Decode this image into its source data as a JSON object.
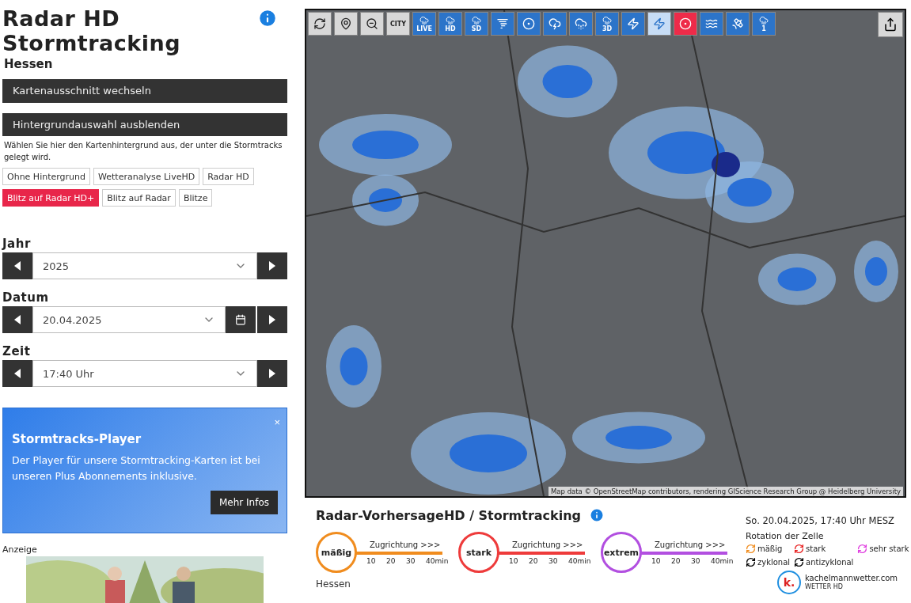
{
  "sidebar": {
    "title": "Radar HD Stormtracking",
    "region": "Hessen",
    "bars": [
      "Kartenausschnitt wechseln",
      "Hintergrundauswahl ausblenden"
    ],
    "background_hint": "Wählen Sie hier den Kartenhintergrund aus, der unter die Stormtracks gelegt wird.",
    "backgrounds": [
      {
        "label": "Ohne Hintergrund",
        "selected": false
      },
      {
        "label": "Wetteranalyse LiveHD",
        "selected": false
      },
      {
        "label": "Radar HD",
        "selected": false
      },
      {
        "label": "Blitz auf Radar HD+",
        "selected": true
      },
      {
        "label": "Blitz auf Radar",
        "selected": false
      },
      {
        "label": "Blitze",
        "selected": false
      }
    ],
    "selectors": [
      {
        "label": "Jahr",
        "value": "2025",
        "calendar": false
      },
      {
        "label": "Datum",
        "value": "20.04.2025",
        "calendar": true
      },
      {
        "label": "Zeit",
        "value": "17:40 Uhr",
        "calendar": false
      }
    ],
    "promo": {
      "close": "×",
      "title": "Stormtracks-Player",
      "text": "Der Player für unsere Stormtracking-Karten ist bei unseren Plus Abonnements inklusive.",
      "button": "Mehr Infos"
    },
    "ad_label": "Anzeige"
  },
  "map": {
    "tools": [
      {
        "kind": "refresh",
        "selected": false
      },
      {
        "kind": "pin",
        "selected": false
      },
      {
        "kind": "zoom",
        "selected": false
      },
      {
        "kind": "city",
        "label": "CITY",
        "selected": false
      },
      {
        "kind": "live",
        "label": "LIVE",
        "selected": false
      },
      {
        "kind": "radar",
        "label": "HD",
        "selected": false
      },
      {
        "kind": "radar",
        "label": "SD",
        "selected": false
      },
      {
        "kind": "tornado",
        "selected": false
      },
      {
        "kind": "ring",
        "selected": false
      },
      {
        "kind": "storm",
        "selected": false
      },
      {
        "kind": "hail",
        "selected": false
      },
      {
        "kind": "radar",
        "label": "3D",
        "selected": false
      },
      {
        "kind": "lightning",
        "selected": false
      },
      {
        "kind": "lightning",
        "selected": true
      },
      {
        "kind": "symbol",
        "selected": false
      },
      {
        "kind": "flood",
        "selected": false
      },
      {
        "kind": "satellite",
        "selected": false
      },
      {
        "kind": "radar",
        "label": "1",
        "selected": false
      }
    ],
    "attribution": "Map data © OpenStreetMap contributors, rendering GIScience Research Group @ Heidelberg University"
  },
  "legend": {
    "title": "Radar-VorhersageHD / Stormtracking",
    "region": "Hessen",
    "timestamp": "So. 20.04.2025, 17:40 Uhr MESZ",
    "tracks": [
      {
        "label": "mäßig",
        "color": "#f08c1e",
        "heading": "Zugrichtung >>>",
        "ticks": [
          "10",
          "20",
          "30",
          "40min"
        ]
      },
      {
        "label": "stark",
        "color": "#ee3b3b",
        "heading": "Zugrichtung >>>",
        "ticks": [
          "10",
          "20",
          "30",
          "40min"
        ]
      },
      {
        "label": "extrem",
        "color": "#b24fe0",
        "heading": "Zugrichtung >>>",
        "ticks": [
          "10",
          "20",
          "30",
          "40min"
        ]
      }
    ],
    "rotation_title": "Rotation der Zelle",
    "rotation": [
      {
        "label": "mäßig",
        "color": "#f08c1e"
      },
      {
        "label": "stark",
        "color": "#e82020"
      },
      {
        "label": "sehr stark",
        "color": "#e040e0"
      },
      {
        "label": "zyklonal",
        "color": "#000000"
      },
      {
        "label": "antizyklonal",
        "color": "#000000"
      }
    ],
    "logo": {
      "mark": "k.",
      "name": "kachelmannwetter.com",
      "sub": "WETTER HD"
    }
  }
}
